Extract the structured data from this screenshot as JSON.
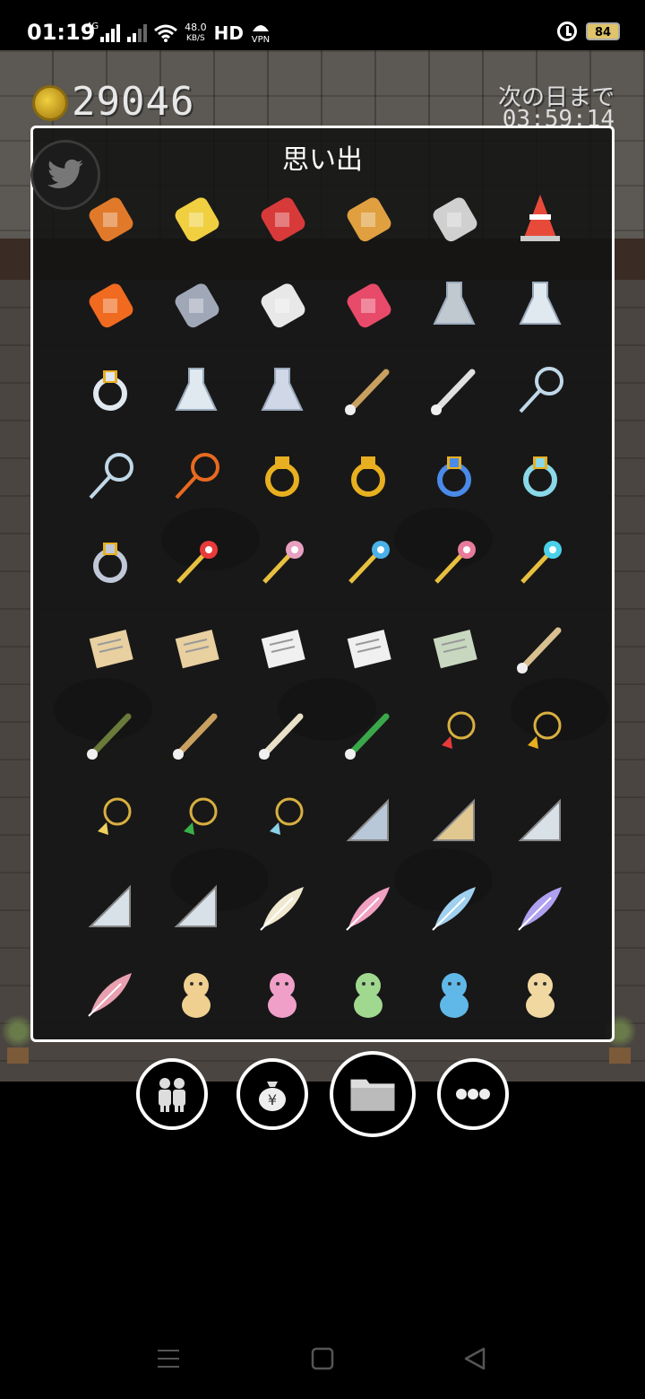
{
  "status_bar": {
    "time": "01:19",
    "network_label": "4G",
    "speed_value": "48.0",
    "speed_unit": "KB/S",
    "hd_label": "HD",
    "vpn_label": "VPN",
    "battery": "84"
  },
  "hud": {
    "coins": "29046",
    "next_day_label": "次の日まで",
    "next_day_timer": "03:59:14"
  },
  "panel": {
    "title": "思い出",
    "items": [
      {
        "name": "pencil-icon",
        "color": "#e07a2a"
      },
      {
        "name": "crayon-icon",
        "color": "#f0d040"
      },
      {
        "name": "paint-tube-icon",
        "color": "#d83a3a"
      },
      {
        "name": "paint-palette-icon",
        "color": "#e0a040"
      },
      {
        "name": "paint-bucket-icon",
        "color": "#d0d0d0"
      },
      {
        "name": "traffic-cone-icon",
        "color": "#e84a3a"
      },
      {
        "name": "megaphone-icon",
        "color": "#f06a20"
      },
      {
        "name": "microphone-icon",
        "color": "#a0a8b8"
      },
      {
        "name": "disguise-glasses-icon",
        "color": "#e8e8e8"
      },
      {
        "name": "party-popper-icon",
        "color": "#e84a6a"
      },
      {
        "name": "dropper-icon",
        "color": "#c0c8d0"
      },
      {
        "name": "flask-icon",
        "color": "#e0e8f0"
      },
      {
        "name": "measuring-cup-icon",
        "color": "#e0e8f0"
      },
      {
        "name": "round-flask-icon",
        "color": "#e0e8f0"
      },
      {
        "name": "alcohol-lamp-icon",
        "color": "#d0d8e8"
      },
      {
        "name": "wooden-bat-icon",
        "color": "#c8a060"
      },
      {
        "name": "baseball-bat-icon",
        "color": "#e0e0e0"
      },
      {
        "name": "tennis-racket-icon",
        "color": "#c0d8e8"
      },
      {
        "name": "badminton-racket-icon",
        "color": "#c0d8e8"
      },
      {
        "name": "fly-swatter-icon",
        "color": "#e86a20"
      },
      {
        "name": "pink-gem-ring-icon",
        "color": "#e8b020"
      },
      {
        "name": "red-gem-ring-icon",
        "color": "#e8b020"
      },
      {
        "name": "blue-gem-ring-icon",
        "color": "#4a8ae8"
      },
      {
        "name": "green-gem-ring-icon",
        "color": "#8ad8e8"
      },
      {
        "name": "moon-ring-icon",
        "color": "#c0c8d8"
      },
      {
        "name": "rose-wand-icon",
        "color": "#e83a3a"
      },
      {
        "name": "star-wand-icon",
        "color": "#e8a0c0"
      },
      {
        "name": "sun-wand-icon",
        "color": "#4ab0e8"
      },
      {
        "name": "flower-wand-icon",
        "color": "#e87a9a"
      },
      {
        "name": "ribbon-wand-icon",
        "color": "#4ad0e8"
      },
      {
        "name": "letter-icon",
        "color": "#e8d0a0"
      },
      {
        "name": "envelope-icon",
        "color": "#e8d0a0"
      },
      {
        "name": "postcard-icon",
        "color": "#f0f0f0"
      },
      {
        "name": "lined-letter-icon",
        "color": "#f0f0f0"
      },
      {
        "name": "stamp-icon",
        "color": "#c8d8c0"
      },
      {
        "name": "stick-icon",
        "color": "#d8c090"
      },
      {
        "name": "paintbrush-icon",
        "color": "#6a7a3a"
      },
      {
        "name": "thin-brush-icon",
        "color": "#c8a060"
      },
      {
        "name": "flat-brush-icon",
        "color": "#e8e0c8"
      },
      {
        "name": "green-brush-icon",
        "color": "#3aa84a"
      },
      {
        "name": "red-gem-pendant-icon",
        "color": "#e83a3a"
      },
      {
        "name": "star-pendant-icon",
        "color": "#e8b020"
      },
      {
        "name": "heart-pendant-icon",
        "color": "#f0d060"
      },
      {
        "name": "clover-pendant-icon",
        "color": "#3ab04a"
      },
      {
        "name": "feather-pendant-icon",
        "color": "#8ad0e8"
      },
      {
        "name": "steel-ruler-icon",
        "color": "#b8c8d8"
      },
      {
        "name": "wooden-ruler-icon",
        "color": "#e0c890"
      },
      {
        "name": "set-square-icon",
        "color": "#d8e0e8"
      },
      {
        "name": "triangle-ruler-icon",
        "color": "#d8e0e8"
      },
      {
        "name": "protractor-icon",
        "color": "#d8e0e8"
      },
      {
        "name": "white-feather-icon",
        "color": "#f0e8d0"
      },
      {
        "name": "pink-feather-icon",
        "color": "#f0a0c0"
      },
      {
        "name": "blue-feather-icon",
        "color": "#a0d0f0"
      },
      {
        "name": "purple-feather-icon",
        "color": "#b0a0f0"
      },
      {
        "name": "quill-icon",
        "color": "#e8a0b0"
      },
      {
        "name": "dog-plush-icon",
        "color": "#f0d090"
      },
      {
        "name": "bear-plush-icon",
        "color": "#f0a0c8"
      },
      {
        "name": "bird-plush-icon",
        "color": "#a0d890"
      },
      {
        "name": "whale-plush-icon",
        "color": "#60b8e8"
      },
      {
        "name": "cat-plush-icon",
        "color": "#f0d8a0"
      }
    ]
  },
  "nav_buttons": [
    {
      "name": "people-button-icon"
    },
    {
      "name": "money-bag-button-icon"
    },
    {
      "name": "folder-button-icon"
    },
    {
      "name": "more-button-icon"
    }
  ]
}
